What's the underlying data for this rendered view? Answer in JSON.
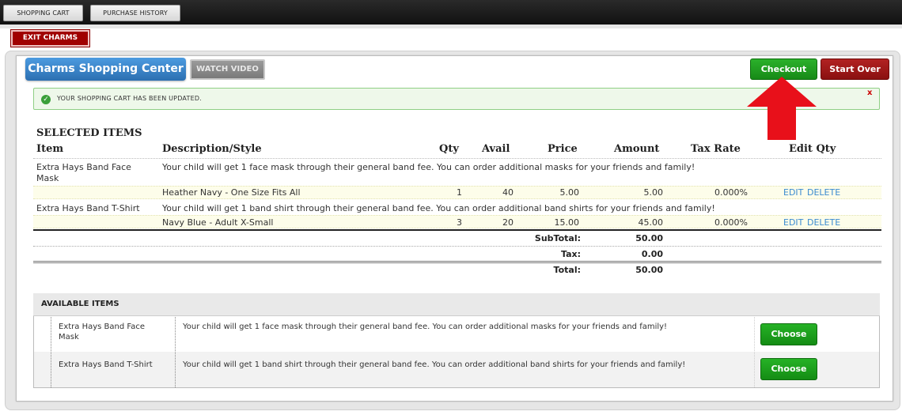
{
  "nav": {
    "shopping_cart": "SHOPPING CART",
    "purchase_history": "PURCHASE HISTORY",
    "exit": "EXIT CHARMS"
  },
  "header": {
    "title": "Charms Shopping Center",
    "watch_video": "WATCH VIDEO",
    "checkout": "Checkout",
    "start_over": "Start Over"
  },
  "alert": {
    "text": "YOUR SHOPPING CART HAS BEEN UPDATED.",
    "close": "x"
  },
  "selected": {
    "heading": "SELECTED ITEMS",
    "columns": [
      "Item",
      "Description/Style",
      "Qty",
      "Avail",
      "Price",
      "Amount",
      "Tax Rate",
      "Edit Qty"
    ],
    "items": [
      {
        "item_line1": "Extra Hays Band Face",
        "item_line2": "Mask",
        "description": "Your child will get 1 face mask through their general band fee. You can order additional masks for your friends and family!",
        "style": "Heather Navy - One Size Fits All",
        "qty": "1",
        "avail": "40",
        "price": "5.00",
        "amount": "5.00",
        "tax_rate": "0.000%",
        "edit": "EDIT",
        "delete": "DELETE"
      },
      {
        "item_line1": "Extra Hays Band T-Shirt",
        "item_line2": "",
        "description": "Your child will get 1 band shirt through their general band fee. You can order additional band shirts for your friends and family!",
        "style": "Navy Blue - Adult X-Small",
        "qty": "3",
        "avail": "20",
        "price": "15.00",
        "amount": "45.00",
        "tax_rate": "0.000%",
        "edit": "EDIT",
        "delete": "DELETE"
      }
    ],
    "subtotal_label": "SubTotal:",
    "subtotal": "50.00",
    "tax_label": "Tax:",
    "tax": "0.00",
    "total_label": "Total:",
    "total": "50.00"
  },
  "available": {
    "heading": "AVAILABLE ITEMS",
    "items": [
      {
        "name_line1": "Extra Hays Band Face",
        "name_line2": "Mask",
        "description": "Your child will get 1 face mask through their general band fee. You can order additional masks for your friends and family!",
        "button": "Choose"
      },
      {
        "name_line1": "Extra Hays Band T-Shirt",
        "name_line2": "",
        "description": "Your child will get 1 band shirt through their general band fee. You can order additional band shirts for your friends and family!",
        "button": "Choose"
      }
    ]
  },
  "colors": {
    "accent_blue": "#2c6fb1",
    "checkout_green": "#178a17",
    "start_over_red": "#8a1010",
    "exit_red": "#a00000",
    "arrow_red": "#e8101a",
    "link_blue": "#3b8bd0"
  },
  "icons": {
    "success": "check-circle-icon",
    "arrow": "red-arrow-up-icon"
  }
}
